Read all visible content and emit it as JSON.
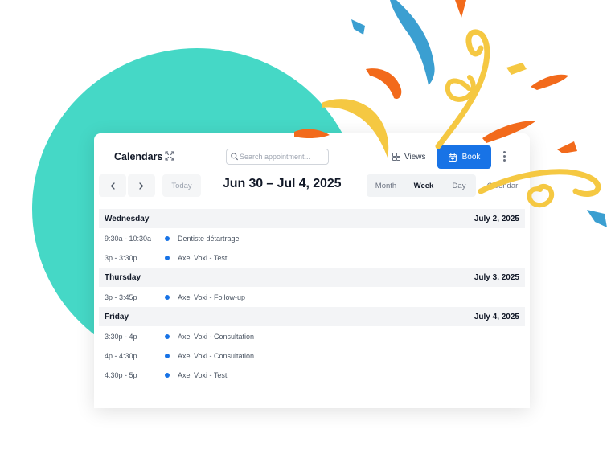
{
  "toolbar": {
    "title": "Calendars",
    "search_placeholder": "Search appointment...",
    "views_label": "Views",
    "book_label": "Book"
  },
  "nav": {
    "today_label": "Today",
    "date_range": "Jun 30 – Jul 4, 2025",
    "view_tabs": [
      "Month",
      "Week",
      "Day"
    ],
    "active_view": "Week",
    "calendar_label": "Calendar"
  },
  "days": [
    {
      "name": "Wednesday",
      "date": "July 2, 2025",
      "appointments": [
        {
          "time": "9:30a - 10:30a",
          "title": "Dentiste détartrage"
        },
        {
          "time": "3p - 3:30p",
          "title": "Axel Voxi - Test"
        }
      ]
    },
    {
      "name": "Thursday",
      "date": "July 3, 2025",
      "appointments": [
        {
          "time": "3p - 3:45p",
          "title": "Axel Voxi - Follow-up"
        }
      ]
    },
    {
      "name": "Friday",
      "date": "July 4, 2025",
      "appointments": [
        {
          "time": "3:30p - 4p",
          "title": "Axel Voxi - Consultation"
        },
        {
          "time": "4p - 4:30p",
          "title": "Axel Voxi - Consultation"
        },
        {
          "time": "4:30p - 5p",
          "title": "Axel Voxi - Test"
        }
      ]
    }
  ],
  "colors": {
    "accent": "#1873e6",
    "blob": "#45d8c6",
    "confetti_orange": "#f26a1b",
    "confetti_yellow": "#f5c842",
    "confetti_blue": "#3b9fd1"
  },
  "icons": [
    "search-icon",
    "views-icon",
    "calendar-add-icon",
    "more-vertical-icon",
    "expand-icon",
    "chevron-left-icon",
    "chevron-right-icon"
  ]
}
